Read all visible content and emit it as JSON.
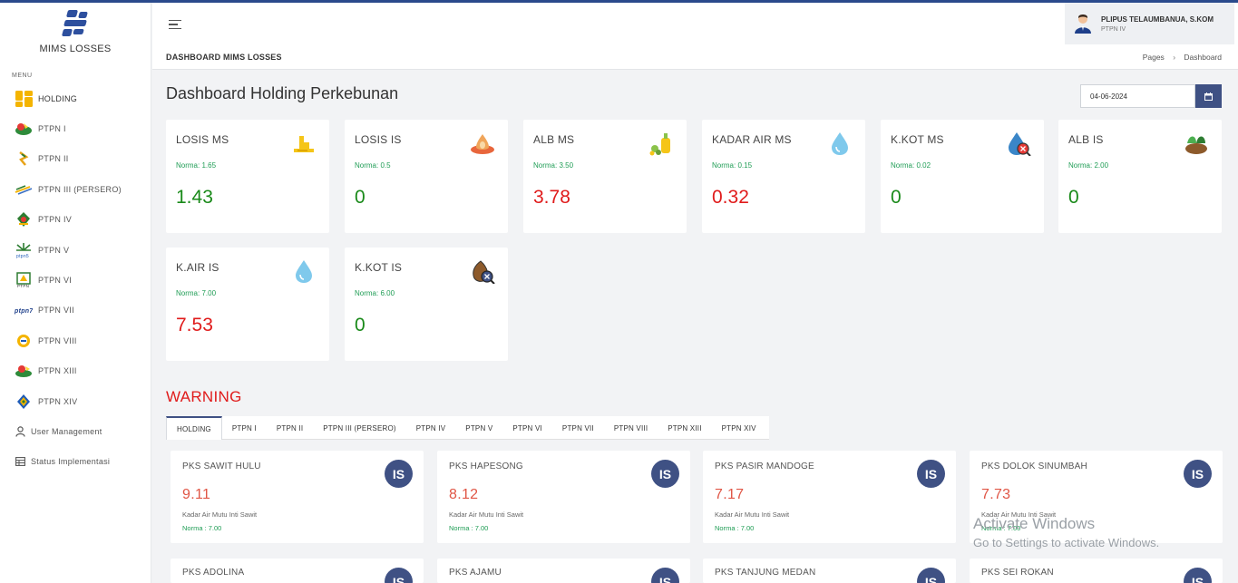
{
  "app": {
    "name": "MIMS LOSSES"
  },
  "sidebar": {
    "menu_label": "MENU",
    "items": [
      {
        "label": "HOLDING",
        "icon": "holding-grid-icon"
      },
      {
        "label": "PTPN I",
        "icon": "ptpn1-logo-icon"
      },
      {
        "label": "PTPN II",
        "icon": "ptpn2-logo-icon"
      },
      {
        "label": "PTPN III (PERSERO)",
        "icon": "ptpn3-logo-icon"
      },
      {
        "label": "PTPN IV",
        "icon": "ptpn4-logo-icon"
      },
      {
        "label": "PTPN V",
        "icon": "ptpn5-logo-icon"
      },
      {
        "label": "PTPN VI",
        "icon": "ptpn6-logo-icon"
      },
      {
        "label": "PTPN VII",
        "icon": "ptpn7-logo-icon"
      },
      {
        "label": "PTPN VIII",
        "icon": "ptpn8-logo-icon"
      },
      {
        "label": "PTPN XIII",
        "icon": "ptpn13-logo-icon"
      },
      {
        "label": "PTPN XIV",
        "icon": "ptpn14-logo-icon"
      },
      {
        "label": "User Management",
        "icon": "user-icon"
      },
      {
        "label": "Status Implementasi",
        "icon": "table-icon"
      }
    ]
  },
  "header": {
    "user_name": "PLIPUS TELAUMBANUA, S.KOM",
    "user_org": "PTPN IV",
    "subtitle": "DASHBOARD MIMS LOSSES",
    "breadcrumb": [
      "Pages",
      "Dashboard"
    ]
  },
  "main": {
    "title": "Dashboard Holding Perkebunan",
    "date": "04-06-2024",
    "stats": [
      {
        "title": "LOSIS MS",
        "norm": "Norma: 1.65",
        "value": "1.43",
        "value_color": "#1a8a1a",
        "icon": "oil-palm-fruit-icon"
      },
      {
        "title": "LOSIS IS",
        "norm": "Norma: 0.5",
        "value": "0",
        "value_color": "#1a8a1a",
        "icon": "kernel-drop-icon"
      },
      {
        "title": "ALB MS",
        "norm": "Norma: 3.50",
        "value": "3.78",
        "value_color": "#e01b1b",
        "icon": "oil-bottle-icon"
      },
      {
        "title": "KADAR AIR MS",
        "norm": "Norma: 0.15",
        "value": "0.32",
        "value_color": "#e01b1b",
        "icon": "water-drop-icon"
      },
      {
        "title": "K.KOT MS",
        "norm": "Norma: 0.02",
        "value": "0",
        "value_color": "#1a8a1a",
        "icon": "dirty-drop-icon"
      },
      {
        "title": "ALB IS",
        "norm": "Norma: 2.00",
        "value": "0",
        "value_color": "#1a8a1a",
        "icon": "kernel-leaf-icon"
      },
      {
        "title": "K.AIR IS",
        "norm": "Norma: 7.00",
        "value": "7.53",
        "value_color": "#e01b1b",
        "icon": "water-drop-icon"
      },
      {
        "title": "K.KOT IS",
        "norm": "Norma: 6.00",
        "value": "0",
        "value_color": "#1a8a1a",
        "icon": "dirty-kernel-icon"
      }
    ],
    "warning_title": "WARNING",
    "tabs": [
      "HOLDING",
      "PTPN I",
      "PTPN II",
      "PTPN III (PERSERO)",
      "PTPN IV",
      "PTPN V",
      "PTPN VI",
      "PTPN VII",
      "PTPN VIII",
      "PTPN XIII",
      "PTPN XIV"
    ],
    "warnings": [
      {
        "name": "PKS SAWIT HULU",
        "value": "9.11",
        "desc": "Kadar Air Mutu Inti Sawit",
        "norm": "Norma : 7.00",
        "badge": "IS"
      },
      {
        "name": "PKS HAPESONG",
        "value": "8.12",
        "desc": "Kadar Air Mutu Inti Sawit",
        "norm": "Norma : 7.00",
        "badge": "IS"
      },
      {
        "name": "PKS PASIR MANDOGE",
        "value": "7.17",
        "desc": "Kadar Air Mutu Inti Sawit",
        "norm": "Norma : 7.00",
        "badge": "IS"
      },
      {
        "name": "PKS DOLOK SINUMBAH",
        "value": "7.73",
        "desc": "Kadar Air Mutu Inti Sawit",
        "norm": "Norma : 7.00",
        "badge": "IS"
      },
      {
        "name": "PKS ADOLINA",
        "badge": "IS"
      },
      {
        "name": "PKS AJAMU",
        "badge": "IS"
      },
      {
        "name": "PKS TANJUNG MEDAN",
        "badge": "IS"
      },
      {
        "name": "PKS SEI ROKAN",
        "badge": "IS"
      }
    ]
  },
  "watermark": {
    "line1": "Activate Windows",
    "line2": "Go to Settings to activate Windows."
  }
}
